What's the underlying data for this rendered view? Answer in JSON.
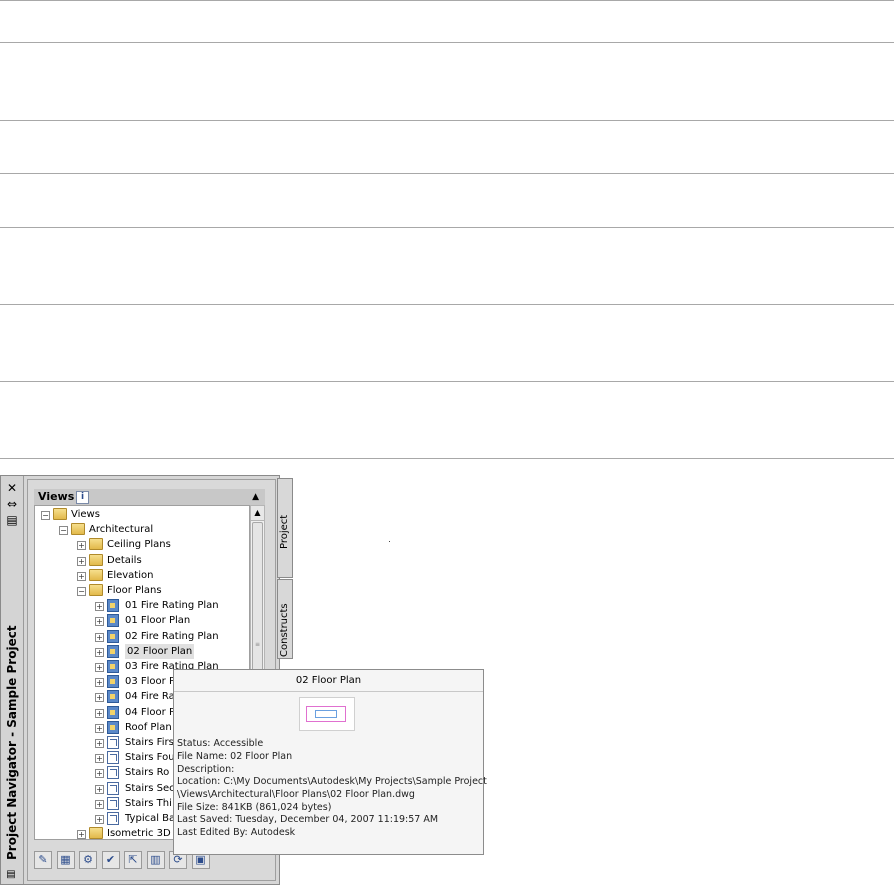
{
  "navigator": {
    "title": "Project Navigator - Sample Project",
    "close_glyph": "✕",
    "autohide_glyph": "⇔",
    "props_glyph": "▤",
    "panel": {
      "header": "Views",
      "info_glyph": "i",
      "collapse_glyph": "▲"
    },
    "tree": [
      {
        "label": "Views",
        "icon": "folder-icon",
        "expander": "−"
      },
      {
        "label": "Architectural",
        "icon": "folder-icon",
        "expander": "−"
      },
      {
        "label": "Ceiling Plans",
        "icon": "folder-icon",
        "expander": "+"
      },
      {
        "label": "Details",
        "icon": "folder-icon",
        "expander": "+"
      },
      {
        "label": "Elevation",
        "icon": "folder-icon",
        "expander": "+"
      },
      {
        "label": "Floor Plans",
        "icon": "folder-icon",
        "expander": "−"
      },
      {
        "label": "01 Fire Rating Plan",
        "icon": "view-icon",
        "expander": "+"
      },
      {
        "label": "01 Floor Plan",
        "icon": "view-icon",
        "expander": "+"
      },
      {
        "label": "02 Fire Rating Plan",
        "icon": "view-icon",
        "expander": "+"
      },
      {
        "label": "02 Floor Plan",
        "icon": "view-icon",
        "expander": "+"
      },
      {
        "label": "03 Fire Rating Plan",
        "icon": "view-icon",
        "expander": "+"
      },
      {
        "label": "03 Floor P",
        "icon": "view-icon",
        "expander": "+"
      },
      {
        "label": "04 Fire Ra",
        "icon": "view-icon",
        "expander": "+"
      },
      {
        "label": "04 Floor P",
        "icon": "view-icon",
        "expander": "+"
      },
      {
        "label": "Roof Plan",
        "icon": "view-icon",
        "expander": "+"
      },
      {
        "label": "Stairs Firs",
        "icon": "section-icon",
        "expander": "+"
      },
      {
        "label": "Stairs Fou",
        "icon": "section-icon",
        "expander": "+"
      },
      {
        "label": "Stairs Ro",
        "icon": "section-icon",
        "expander": "+"
      },
      {
        "label": "Stairs Sec",
        "icon": "section-icon",
        "expander": "+"
      },
      {
        "label": "Stairs Thi",
        "icon": "section-icon",
        "expander": "+"
      },
      {
        "label": "Typical Ba",
        "icon": "section-icon",
        "expander": "+"
      },
      {
        "label": "Isometric 3D",
        "icon": "folder-icon",
        "expander": "+"
      }
    ],
    "tabs": [
      "Project",
      "Constructs"
    ],
    "toolbar": [
      "✎",
      "▦",
      "⚙",
      "✔",
      "⇱",
      "▥",
      "⟳",
      "▣"
    ]
  },
  "tooltip": {
    "title": "02 Floor Plan",
    "lines": [
      "Status: Accessible",
      "File Name: 02 Floor Plan",
      "Description:",
      "Location: C:\\My Documents\\Autodesk\\My Projects\\Sample Project",
      "\\Views\\Architectural\\Floor Plans\\02 Floor Plan.dwg",
      "File Size: 841KB (861,024 bytes)",
      "Last Saved: Tuesday, December 04, 2007  11:19:57 AM",
      "Last Edited By: Autodesk"
    ]
  }
}
